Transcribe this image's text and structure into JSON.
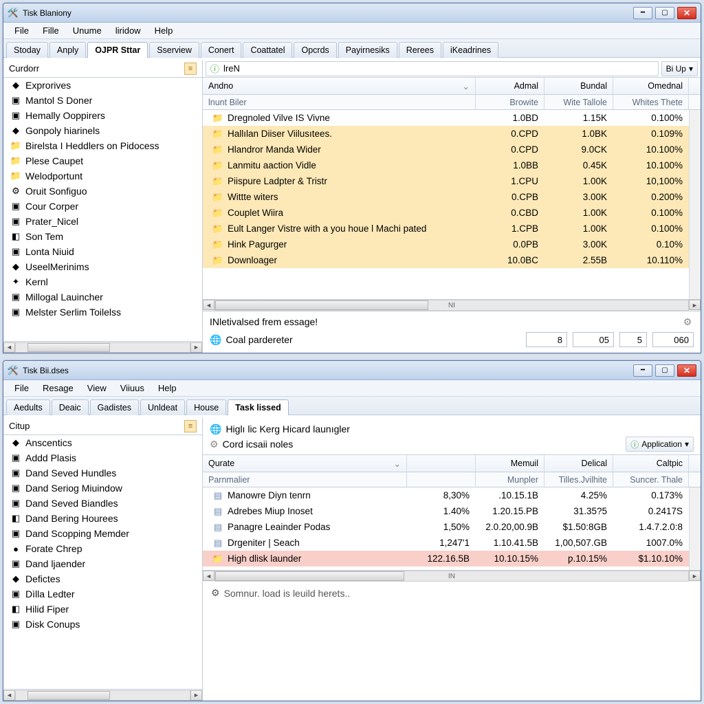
{
  "win1": {
    "title": "Tisk Blaniony",
    "menus": [
      "File",
      "Fille",
      "Unume",
      "liridow",
      "Help"
    ],
    "tabs": [
      "Stoday",
      "Anply",
      "OJPR Sttar",
      "Sserview",
      "Conert",
      "Coattatel",
      "Opcrds",
      "Payirnesiks",
      "Rerees",
      "iKeadrines"
    ],
    "active_tab": 2,
    "sidebar_head": "Curdorr",
    "sidebar": [
      {
        "icon": "◆",
        "label": "Exprorives",
        "cls": "c-green"
      },
      {
        "icon": "▣",
        "label": "Mantol S Doner",
        "cls": "c-blue"
      },
      {
        "icon": "▣",
        "label": "Hemally Ooppirers",
        "cls": "c-blue"
      },
      {
        "icon": "◆",
        "label": "Gonpoly hiarinels",
        "cls": "c-green"
      },
      {
        "icon": "📁",
        "label": "Birelsta I Heddlers on Pidocess",
        "cls": "folder"
      },
      {
        "icon": "📁",
        "label": "Plese Caupet",
        "cls": "folder"
      },
      {
        "icon": "📁",
        "label": "Welodportunt",
        "cls": "folder"
      },
      {
        "icon": "⚙",
        "label": "Oruit Sonfiguo",
        "cls": "c-gray"
      },
      {
        "icon": "▣",
        "label": "Cour Corper",
        "cls": "c-blue"
      },
      {
        "icon": "▣",
        "label": "Prater_Nicel",
        "cls": "c-gray"
      },
      {
        "icon": "◧",
        "label": "Son Tem",
        "cls": "c-olive"
      },
      {
        "icon": "▣",
        "label": "Lonta Niuid",
        "cls": "c-blue"
      },
      {
        "icon": "◆",
        "label": "UseelMerinims",
        "cls": "c-green"
      },
      {
        "icon": "✦",
        "label": "Kernl",
        "cls": "c-red"
      },
      {
        "icon": "▣",
        "label": "Millogal Lauincher",
        "cls": "c-blue"
      },
      {
        "icon": "▣",
        "label": "Melster Serlim Toilelss",
        "cls": "c-blue"
      }
    ],
    "address": "lreN",
    "address_btn": "Bi Up",
    "columns": [
      "Andno",
      "Admal",
      "Bundal",
      "Omednal"
    ],
    "subcolumns": [
      "lnunt Biler",
      "Browite",
      "Wite Tallole",
      "Whites Thete"
    ],
    "rows": [
      {
        "hl": false,
        "name": "Dregnoled Vilve IS Vivne",
        "a": "1.0BD",
        "b": "1.15K",
        "c": "0.100%"
      },
      {
        "hl": true,
        "name": "Hallılan Diiser Viilusıtees.",
        "a": "0.CPD",
        "b": "1.0BK",
        "c": "0.109%"
      },
      {
        "hl": true,
        "name": "Hlandror Manda Wider",
        "a": "0.CPD",
        "b": "9.0CK",
        "c": "10.100%"
      },
      {
        "hl": true,
        "name": "Lanmitu aaction Vidle",
        "a": "1.0BB",
        "b": "0.45K",
        "c": "10.100%"
      },
      {
        "hl": true,
        "name": "Piispure Ladpter & Tristr",
        "a": "1.CPU",
        "b": "1.00K",
        "c": "10,100%"
      },
      {
        "hl": true,
        "name": "Wittte witers",
        "a": "0.CPB",
        "b": "3.00K",
        "c": "0.200%"
      },
      {
        "hl": true,
        "name": "Couplet Wiira",
        "a": "0.CBD",
        "b": "1.00K",
        "c": "0.100%"
      },
      {
        "hl": true,
        "name": "Eult Langer Vistre with a you houe l Machi pated",
        "a": "1.CPB",
        "b": "1.00K",
        "c": "0.100%"
      },
      {
        "hl": true,
        "name": "Hink Pagurger",
        "a": "0.0PB",
        "b": "3.00K",
        "c": "0.10%"
      },
      {
        "hl": true,
        "name": "Downloager",
        "a": "10.0BC",
        "b": "2.55B",
        "c": "10.110%"
      }
    ],
    "status_msg": "INletivalsed frem essage!",
    "status_sub": "Coal pardereter",
    "fields": [
      "8",
      "05",
      "5",
      "060"
    ]
  },
  "win2": {
    "title": "Tisk Bii.dses",
    "menus": [
      "File",
      "Resage",
      "View",
      "Viiuus",
      "Help"
    ],
    "tabs": [
      "Aedults",
      "Deaic",
      "Gadistes",
      "Unldeat",
      "House",
      "Task lissed"
    ],
    "active_tab": 5,
    "sidebar_head": "Citup",
    "sidebar": [
      {
        "icon": "◆",
        "label": "Anscentics",
        "cls": "c-blue"
      },
      {
        "icon": "▣",
        "label": "Addd Plasis",
        "cls": "c-blue"
      },
      {
        "icon": "▣",
        "label": "Dand Seved Hundles",
        "cls": "c-blue"
      },
      {
        "icon": "▣",
        "label": "Dand Seriog Miuindow",
        "cls": "c-blue"
      },
      {
        "icon": "▣",
        "label": "Dand Seved Biandles",
        "cls": "c-blue"
      },
      {
        "icon": "◧",
        "label": "Dand Bering Hourees",
        "cls": "c-red"
      },
      {
        "icon": "▣",
        "label": "Dand Scopping Memder",
        "cls": "c-blue"
      },
      {
        "icon": "●",
        "label": "Forate Chrep",
        "cls": "c-green"
      },
      {
        "icon": "▣",
        "label": "Dand ljaender",
        "cls": "c-blue"
      },
      {
        "icon": "◆",
        "label": "Defictes",
        "cls": "c-blue"
      },
      {
        "icon": "▣",
        "label": "Dìlla Ledter",
        "cls": "c-blue"
      },
      {
        "icon": "◧",
        "label": "Hilid Fiper",
        "cls": "c-red"
      },
      {
        "icon": "▣",
        "label": "Disk Conups",
        "cls": "c-blue"
      }
    ],
    "info_line1": "Higlı lic Kerg Hicard launıgler",
    "info_line2": "Cord icsaii noles",
    "info_button": "Application",
    "columns": [
      "Qurate",
      "",
      "Memuil",
      "Delical",
      "Caltpic"
    ],
    "subcolumns": [
      "Parnmalier",
      "",
      "Munpler",
      "Tilles.Jvilhite",
      "Suncer. Thale"
    ],
    "rows": [
      {
        "hl": false,
        "name": "Manowre Diyn tenrn",
        "q": "8,30%",
        "a": ".10.15.1B",
        "b": "4.25%",
        "c": "0.173%"
      },
      {
        "hl": false,
        "name": "Adrebes Miup Inoset",
        "q": "1.40%",
        "a": "1.20.15.PB",
        "b": "31.35?5",
        "c": "0.2417S"
      },
      {
        "hl": false,
        "name": "Panagre Leainder Podas",
        "q": "1,50%",
        "a": "2.0.20,00.9B",
        "b": "$1.50:8GB",
        "c": "1.4.7.2.0:8"
      },
      {
        "hl": false,
        "name": "Drgeniter | Seach",
        "q": "1,247'1",
        "a": "1.10.41.5B",
        "b": "1,00,507.GB",
        "c": "1007.0%"
      },
      {
        "hl": true,
        "name": "High dlisk launder",
        "q": "122.16.5B",
        "a": "10.10.15%",
        "b": "ƿ.10.15%",
        "c": "$1.10.10%"
      }
    ],
    "status": "Somnur. load is leuild herets.."
  }
}
